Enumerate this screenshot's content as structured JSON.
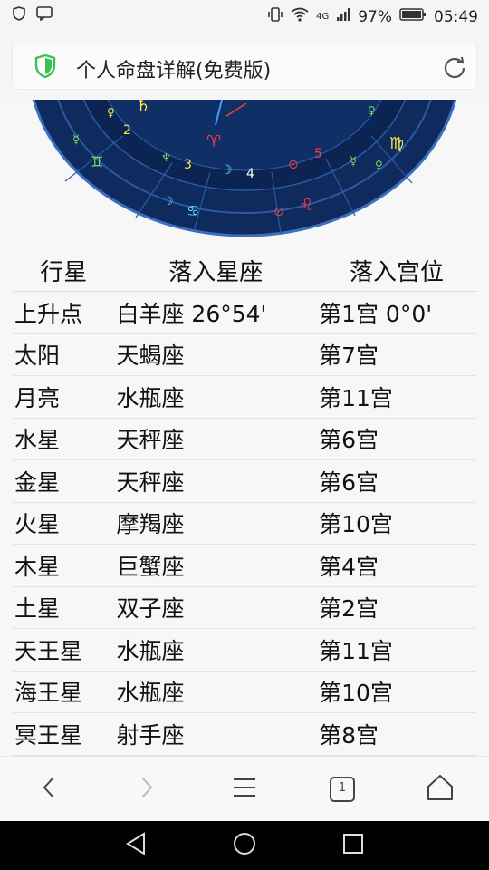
{
  "status_bar": {
    "network": "4G",
    "battery_percent": "97%",
    "time": "05:49"
  },
  "browser": {
    "page_title": "个人命盘详解(免费版)"
  },
  "table": {
    "headers": [
      "行星",
      "落入星座",
      "落入宫位"
    ],
    "rows": [
      [
        "上升点",
        "白羊座 26°54'",
        "第1宫 0°0'"
      ],
      [
        "太阳",
        "天蝎座",
        "第7宫"
      ],
      [
        "月亮",
        "水瓶座",
        "第11宫"
      ],
      [
        "水星",
        "天秤座",
        "第6宫"
      ],
      [
        "金星",
        "天秤座",
        "第6宫"
      ],
      [
        "火星",
        "摩羯座",
        "第10宫"
      ],
      [
        "木星",
        "巨蟹座",
        "第4宫"
      ],
      [
        "土星",
        "双子座",
        "第2宫"
      ],
      [
        "天王星",
        "水瓶座",
        "第11宫"
      ],
      [
        "海王星",
        "水瓶座",
        "第10宫"
      ],
      [
        "冥王星",
        "射手座",
        "第8宫"
      ]
    ]
  },
  "chart_wheel": {
    "house_numbers": [
      "2",
      "3",
      "4",
      "5"
    ],
    "colors": {
      "wheel_bg": "#0f2a5c",
      "ring": "#1e4a8c",
      "text_yellow": "#ffe84a",
      "text_green": "#78e05a",
      "text_red": "#ff3b3b",
      "text_cyan": "#5fe0ff"
    }
  },
  "bottom_nav": {
    "tab_count": "1"
  },
  "colors": {
    "shield_green": "#3cbf55",
    "icon_grey": "#555555"
  }
}
